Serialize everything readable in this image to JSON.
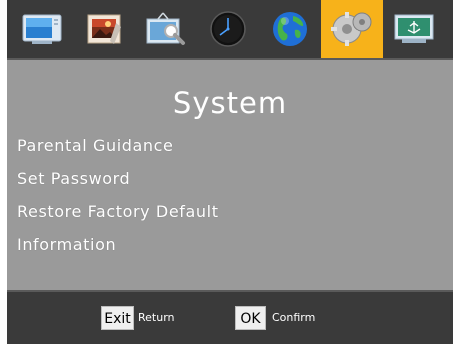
{
  "menu_title": "System",
  "tabs": [
    {
      "icon": "tv-icon",
      "active": false
    },
    {
      "icon": "picture-icon",
      "active": false
    },
    {
      "icon": "channel-search-icon",
      "active": false
    },
    {
      "icon": "clock-icon",
      "active": false
    },
    {
      "icon": "globe-icon",
      "active": false
    },
    {
      "icon": "gears-icon",
      "active": true
    },
    {
      "icon": "usb-icon",
      "active": false
    }
  ],
  "menu_items": [
    {
      "label": "Parental Guidance"
    },
    {
      "label": "Set Password"
    },
    {
      "label": "Restore Factory Default"
    },
    {
      "label": "Information"
    }
  ],
  "footer": {
    "exit_key": "Exit",
    "exit_hint": "Return",
    "ok_key": "OK",
    "ok_hint": "Confirm"
  },
  "colors": {
    "active_tab": "#f7b21a",
    "panel": "#9a9a9a",
    "bar": "#3a3a3a"
  }
}
